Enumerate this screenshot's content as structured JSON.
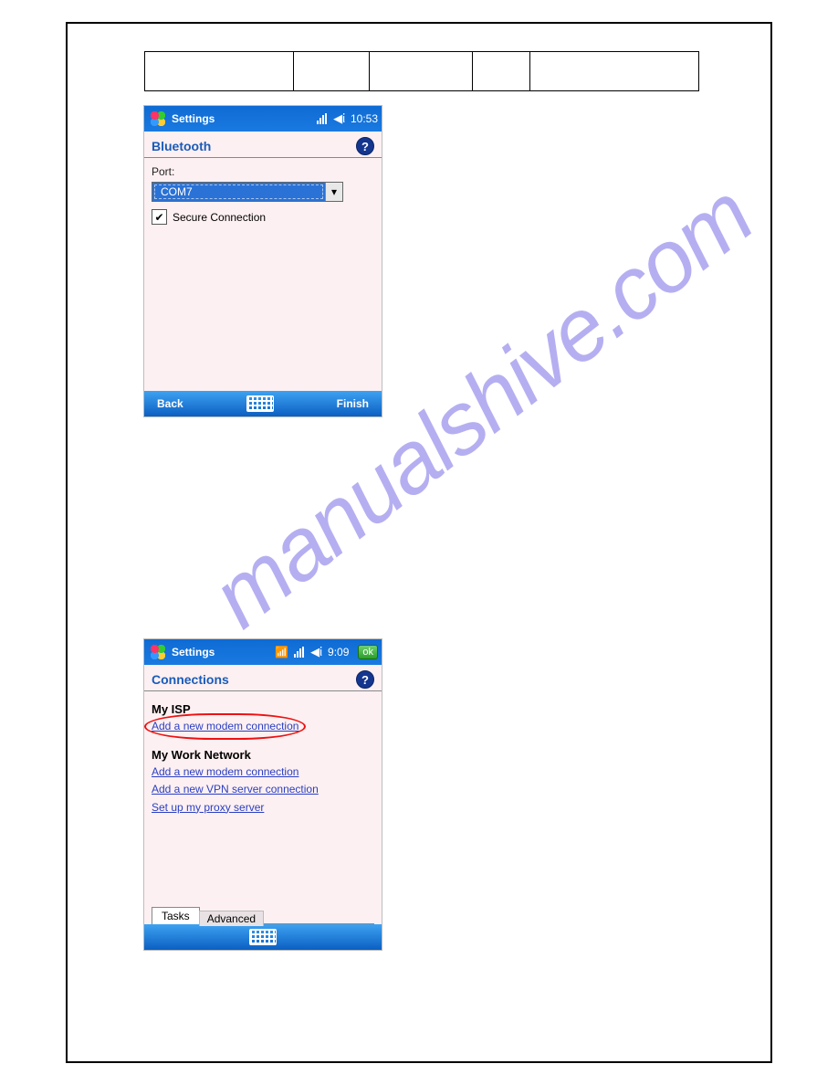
{
  "watermark": "manualshive.com",
  "screen1": {
    "titlebar_title": "Settings",
    "clock": "10:53",
    "subtitle": "Bluetooth",
    "port_label": "Port:",
    "port_value": "COM7",
    "secure_label": "Secure Connection",
    "back_label": "Back",
    "finish_label": "Finish"
  },
  "screen2": {
    "titlebar_title": "Settings",
    "clock": "9:09",
    "ok_label": "ok",
    "subtitle": "Connections",
    "my_isp_heading": "My ISP",
    "isp_add_modem": "Add a new modem connection",
    "my_work_heading": "My Work Network",
    "work_add_modem": "Add a new modem connection",
    "work_add_vpn": "Add a new VPN server connection",
    "work_proxy": "Set up my proxy server",
    "tab_tasks": "Tasks",
    "tab_advanced": "Advanced"
  }
}
